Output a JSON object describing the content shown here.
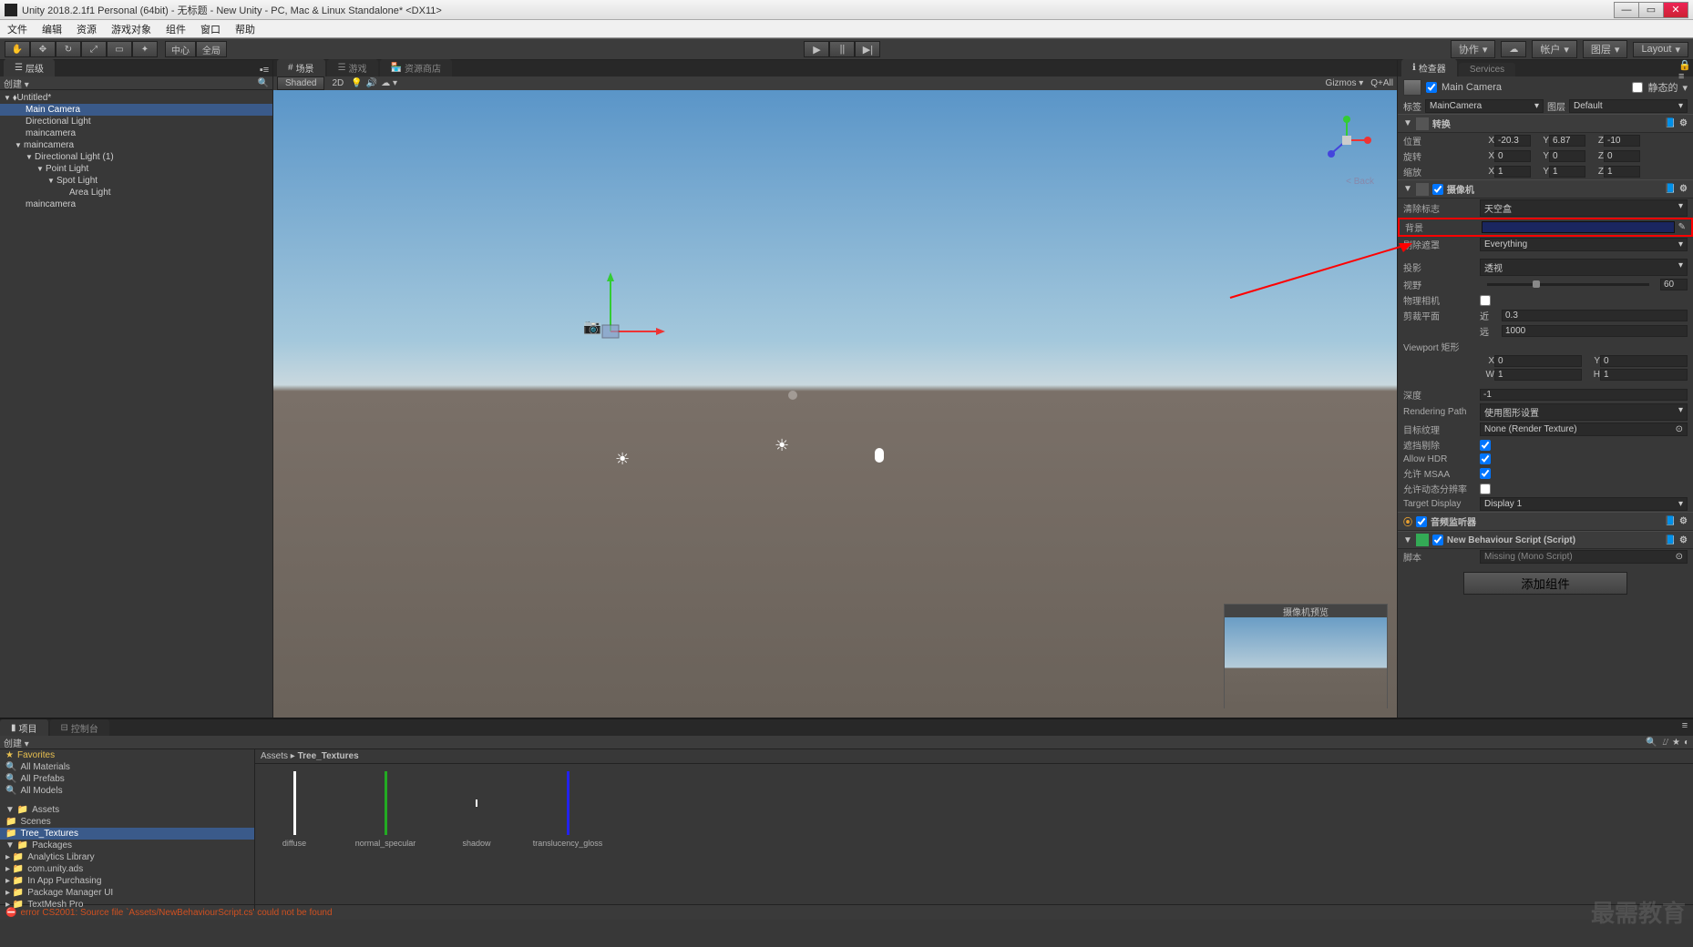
{
  "window": {
    "title": "Unity 2018.2.1f1 Personal (64bit) - 无标题 - New Unity - PC, Mac & Linux Standalone* <DX11>"
  },
  "menu": [
    "文件",
    "编辑",
    "资源",
    "游戏对象",
    "组件",
    "窗口",
    "帮助"
  ],
  "toolbar": {
    "pivot": "中心",
    "space": "全局",
    "collab": "协作",
    "account": "帐户",
    "layers": "图层",
    "layout": "Layout"
  },
  "hierarchy": {
    "tab": "层级",
    "create": "创建",
    "scene": "Untitled*",
    "items": [
      "Main Camera",
      "Directional Light",
      "maincamera",
      "maincamera",
      "Directional Light (1)",
      "Point Light",
      "Spot Light",
      "Area Light",
      "maincamera"
    ]
  },
  "scene": {
    "tabs": [
      "场景",
      "游戏",
      "资源商店"
    ],
    "shaded": "Shaded",
    "mode2d": "2D",
    "gizmos": "Gizmos",
    "all": "Q+All",
    "back": "< Back",
    "camera_preview_title": "摄像机预览"
  },
  "inspector": {
    "tabs": [
      "检查器",
      "Services"
    ],
    "static": "静态的",
    "go_name": "Main Camera",
    "tag_label": "标签",
    "tag_value": "MainCamera",
    "layer_label": "图层",
    "layer_value": "Default",
    "transform": {
      "title": "转换",
      "pos_label": "位置",
      "rot_label": "旋转",
      "scale_label": "缩放",
      "pos": {
        "x": "-20.3",
        "y": "6.87",
        "z": "-10"
      },
      "rot": {
        "x": "0",
        "y": "0",
        "z": "0"
      },
      "scale": {
        "x": "1",
        "y": "1",
        "z": "1"
      }
    },
    "camera": {
      "title": "摄像机",
      "clear_flags_label": "清除标志",
      "clear_flags": "天空盒",
      "background_label": "背景",
      "culling_label": "剔除遮罩",
      "culling": "Everything",
      "projection_label": "投影",
      "projection": "透视",
      "fov_label": "视野",
      "fov": "60",
      "phys_label": "物理相机",
      "clip_label": "剪裁平面",
      "near_label": "近",
      "near": "0.3",
      "far_label": "远",
      "far": "1000",
      "viewport_label": "Viewport 矩形",
      "vx": "0",
      "vy": "0",
      "vw": "1",
      "vh": "1",
      "depth_label": "深度",
      "depth": "-1",
      "rpath_label": "Rendering Path",
      "rpath": "使用图形设置",
      "rtex_label": "目标纹理",
      "rtex": "None (Render Texture)",
      "occ_label": "遮挡剔除",
      "hdr_label": "Allow HDR",
      "msaa_label": "允许 MSAA",
      "dynres_label": "允许动态分辨率",
      "tdisplay_label": "Target Display",
      "tdisplay": "Display 1"
    },
    "audio_listener": "音频监听器",
    "script": {
      "title": "New Behaviour Script (Script)",
      "script_label": "脚本",
      "script_value": "Missing (Mono Script)"
    },
    "add_component": "添加组件"
  },
  "project": {
    "tabs": [
      "项目",
      "控制台"
    ],
    "create": "创建",
    "favorites": "Favorites",
    "fav_items": [
      "All Materials",
      "All Prefabs",
      "All Models"
    ],
    "assets": "Assets",
    "asset_folders": [
      "Scenes",
      "Tree_Textures"
    ],
    "packages": "Packages",
    "package_folders": [
      "Analytics Library",
      "com.unity.ads",
      "In App Purchasing",
      "Package Manager UI",
      "TextMesh Pro"
    ],
    "breadcrumb": [
      "Assets",
      "Tree_Textures"
    ],
    "asset_items": [
      "diffuse",
      "normal_specular",
      "shadow",
      "translucency_gloss"
    ]
  },
  "status": {
    "error": "error CS2001: Source file `Assets/NewBehaviourScript.cs' could not be found"
  },
  "watermark": "最需教育"
}
